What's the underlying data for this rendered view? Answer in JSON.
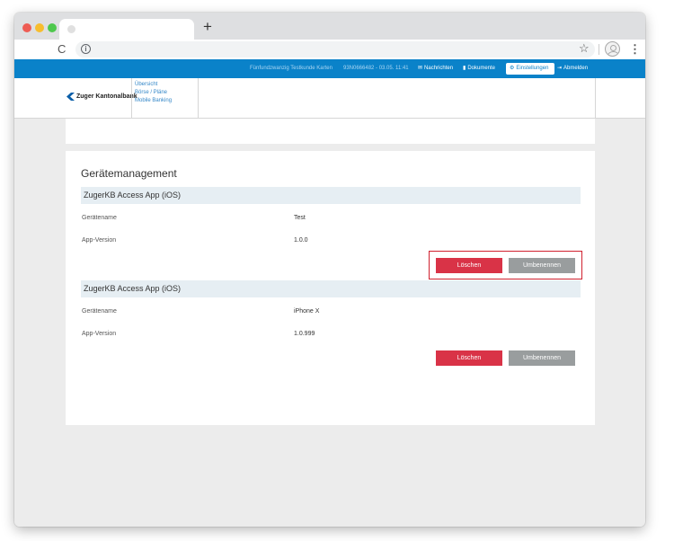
{
  "browser": {
    "new_tab_glyph": "+",
    "reload_glyph": "C",
    "info_glyph": "i",
    "star_glyph": "☆",
    "menu_glyph": "⋮"
  },
  "topbar": {
    "portfolio_name": "Fünfundzwanzig Testkunde Karten",
    "account_info": "93N0666482 - 03.05. 11:41",
    "messages_label": "Nachrichten",
    "documents_label": "Dokumente",
    "settings_label": "Einstellungen",
    "logout_label": "Abmelden",
    "accent_color": "#0a82c9"
  },
  "header": {
    "logo_text": "Zuger Kantonalbank",
    "nav": [
      {
        "label": "Übersicht"
      },
      {
        "label": "Börse / Pläne"
      },
      {
        "label": "Mobile Banking"
      }
    ]
  },
  "main": {
    "title": "Gerätemanagement",
    "devices": [
      {
        "name": "ZugerKB Access App (iOS)",
        "device_name_label": "Gerätename",
        "device_name_value": "Test",
        "version_label": "App-Version",
        "version_value": "1.0.0",
        "delete_label": "Löschen",
        "rename_label": "Umbenennen"
      },
      {
        "name": "ZugerKB Access App (iOS)",
        "device_name_label": "Gerätename",
        "device_name_value": "iPhone X",
        "version_label": "App-Version",
        "version_value": "1.0.999",
        "delete_label": "Löschen",
        "rename_label": "Umbenennen"
      }
    ]
  },
  "colors": {
    "delete": "#d93347",
    "rename": "#999d9e",
    "highlight": "#d0212f"
  }
}
